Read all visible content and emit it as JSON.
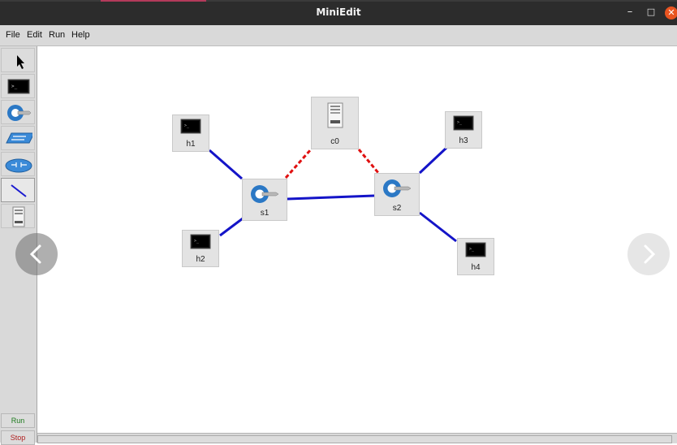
{
  "window": {
    "title": "MiniEdit"
  },
  "menu": {
    "file": "File",
    "edit": "Edit",
    "run": "Run",
    "help": "Help"
  },
  "toolbar": {
    "run_label": "Run",
    "stop_label": "Stop"
  },
  "topology": {
    "hosts": [
      "h1",
      "h2",
      "h3",
      "h4"
    ],
    "switches": [
      "s1",
      "s2"
    ],
    "controller": "c0"
  },
  "colors": {
    "link": "#1414c8",
    "controller_link": "#e01010",
    "close": "#e95420"
  }
}
